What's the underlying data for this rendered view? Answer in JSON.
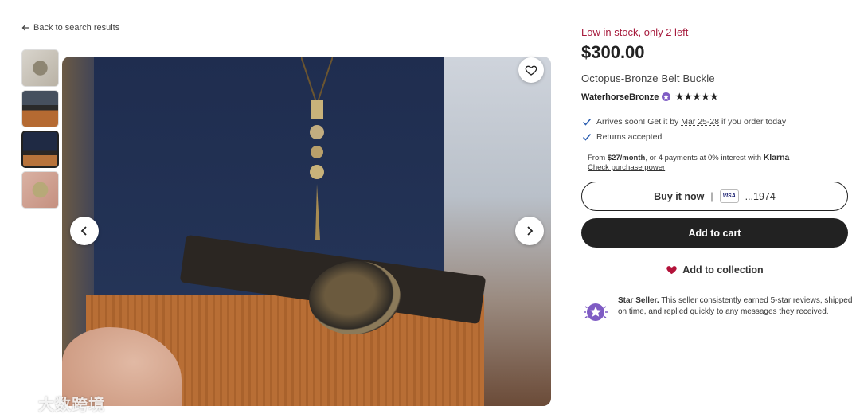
{
  "nav": {
    "back_label": "Back to search results"
  },
  "gallery": {
    "thumbnails": [
      "buckle-thumb-1",
      "belt-thumb-2",
      "outfit-thumb-3",
      "buckle-thumb-4"
    ],
    "active_index": 2
  },
  "watermark": {
    "text": "大数跨境"
  },
  "listing": {
    "stock_text": "Low in stock, only 2 left",
    "price": "$300.00",
    "title": "Octopus-Bronze Belt Buckle",
    "seller": "WaterhorseBronze",
    "rating": 5,
    "stars": "★★★★★"
  },
  "shipping": {
    "arrives_prefix": "Arrives soon! Get it by ",
    "arrives_dates": "Mar 25-28",
    "arrives_suffix": " if you order today",
    "returns": "Returns accepted"
  },
  "klarna": {
    "prefix": "From ",
    "amount": "$27/month",
    "suffix": ", or 4 payments at 0% interest with ",
    "brand": "Klarna",
    "link": "Check purchase power"
  },
  "actions": {
    "buy_now": "Buy it now",
    "separator": "|",
    "card_brand": "VISA",
    "card_last4": "...1974",
    "add_to_cart": "Add to cart",
    "add_to_collection": "Add to collection"
  },
  "star_seller": {
    "title": "Star Seller.",
    "body": " This seller consistently earned 5-star reviews, shipped on time, and replied quickly to any messages they received."
  },
  "colors": {
    "stock_red": "#a61a3c",
    "dark": "#222222",
    "badge_purple": "#7f5cc4",
    "heart_red": "#b3123a"
  }
}
